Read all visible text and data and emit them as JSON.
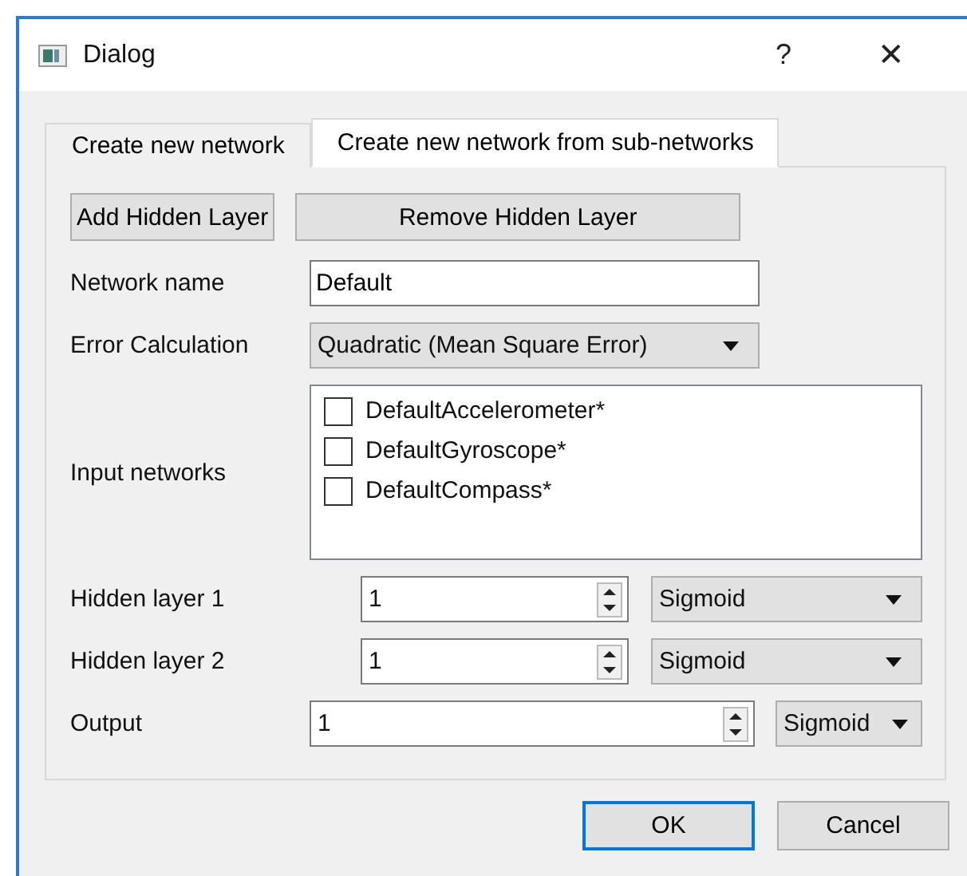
{
  "window": {
    "title": "Dialog",
    "help": "?",
    "close": "✕"
  },
  "tabs": [
    {
      "label": "Create new network",
      "selected": false
    },
    {
      "label": "Create new network from sub-networks",
      "selected": true
    }
  ],
  "layer_buttons": [
    "Add Hidden Layer",
    "Remove Hidden Layer"
  ],
  "network_name": {
    "label": "Network name",
    "value": "Default"
  },
  "error_calculation": {
    "label": "Error Calculation",
    "value": "Quadratic (Mean Square Error)"
  },
  "input_networks": {
    "label": "Input networks",
    "items": [
      {
        "label": "DefaultAccelerometer*",
        "checked": false
      },
      {
        "label": "DefaultGyroscope*",
        "checked": false
      },
      {
        "label": "DefaultCompass*",
        "checked": false
      }
    ]
  },
  "hidden_layers": [
    {
      "label": "Hidden layer 1",
      "value": "1",
      "activation": "Sigmoid"
    },
    {
      "label": "Hidden layer 2",
      "value": "1",
      "activation": "Sigmoid"
    }
  ],
  "output": {
    "label": "Output",
    "value": "1",
    "activation": "Sigmoid"
  },
  "buttons": [
    {
      "label": "OK",
      "default": true
    },
    {
      "label": "Cancel",
      "default": false
    }
  ]
}
